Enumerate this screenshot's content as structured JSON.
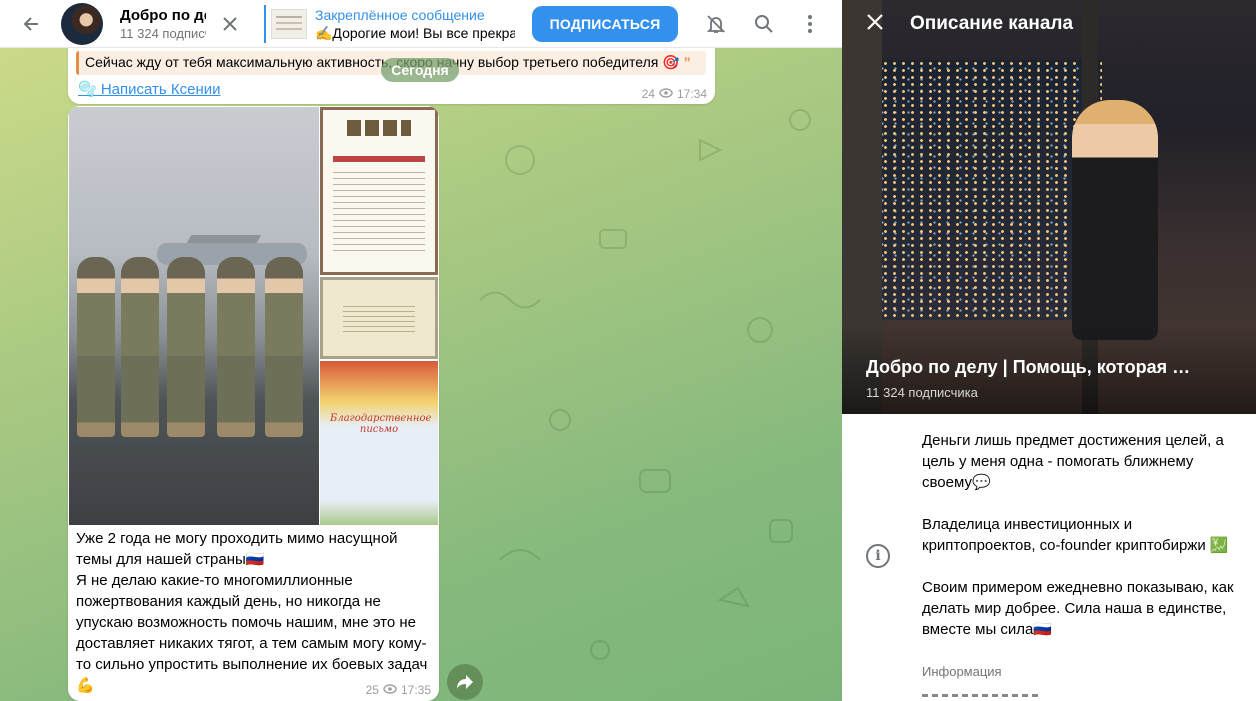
{
  "header": {
    "channel_title": "Добро по делу | Помощь, которая …",
    "subscribers": "11 324 подписчика",
    "pinned_label": "Закреплённое сообщение",
    "pinned_text": "✍️Дорогие мои! Вы все прекрасно знаете…",
    "subscribe_label": "ПОДПИСАТЬСЯ",
    "icons": [
      "back-arrow-icon",
      "close-icon",
      "mute-bell-icon",
      "search-icon",
      "more-vertical-icon"
    ]
  },
  "chat": {
    "date_separator": "Сегодня",
    "message1": {
      "quote_text": "Сейчас жду от тебя максимальную активность, скоро начну выбор третьего победителя 🎯",
      "link_text": "🫧 Написать Ксении",
      "views": "24",
      "time": "17:34"
    },
    "message2": {
      "text": "Уже 2 года не могу проходить мимо насущной темы для нашей страны🇷🇺\nЯ не делаю какие-то многомиллионные пожертвования каждый день, но никогда не упускаю возможность помочь нашим, мне это не доставляет никаких тягот, а тем самым могу кому-то сильно упростить выполнение их боевых задач💪",
      "views": "25",
      "time": "17:35",
      "doc3_title": "Благодарственное письмо"
    }
  },
  "info_panel": {
    "heading": "Описание канала",
    "name": "Добро по делу | Помощь, которая …",
    "subscribers": "11 324 подписчика",
    "description": "Деньги лишь предмет достижения целей, а цель у меня одна - помогать ближнему своему💬\n\nВладелица инвестиционных и криптопроектов, co-founder криптобиржи 💹\n\nСвоим примером ежедневно показываю, как делать мир добрее. Сила наша в единстве, вместе мы сила🇷🇺",
    "description_label": "Информация"
  },
  "colors": {
    "accent": "#3390ec",
    "quote_border": "#e58d45"
  }
}
